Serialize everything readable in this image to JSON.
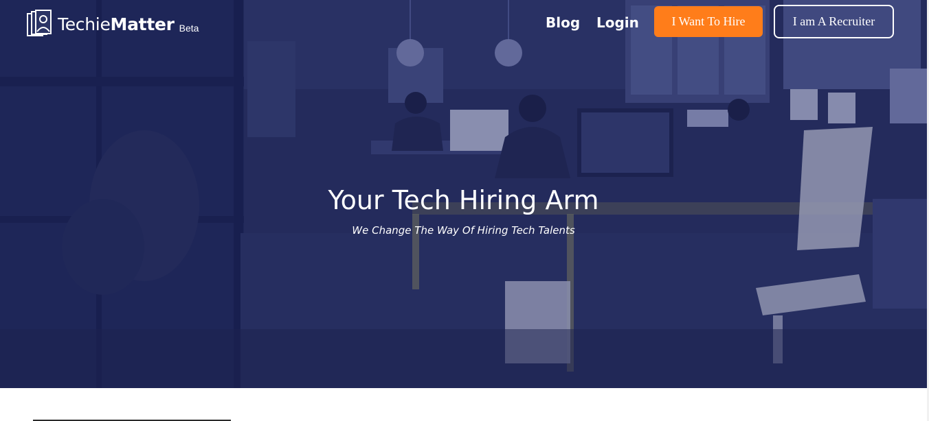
{
  "brand": {
    "name_light": "Techie",
    "name_bold": "Matter",
    "tag": "Beta"
  },
  "nav": {
    "blog": "Blog",
    "login": "Login",
    "hire_button": "I Want To Hire",
    "recruiter_button": "I am A Recruiter"
  },
  "hero": {
    "title": "Your Tech Hiring Arm",
    "subtitle": "We Change The Way Of Hiring Tech Talents",
    "background_image": "office-workspace-photo"
  },
  "colors": {
    "hire_button": "#ff7d1a",
    "overlay": "#263063"
  }
}
